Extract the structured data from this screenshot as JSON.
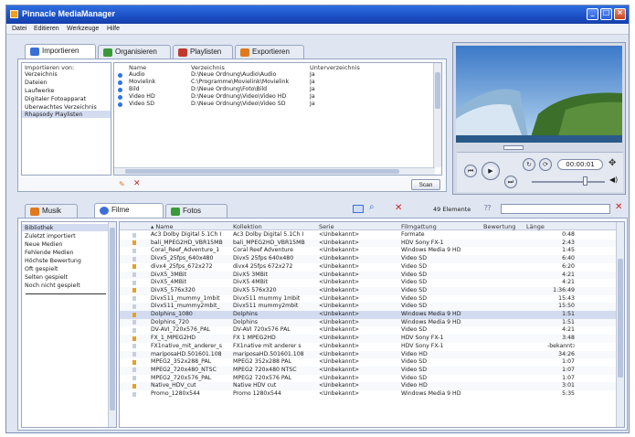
{
  "window": {
    "title": "Pinnacle MediaManager"
  },
  "menu": [
    "Datei",
    "Editieren",
    "Werkzeuge",
    "Hilfe"
  ],
  "top_tabs": [
    {
      "label": "Importieren",
      "icon": "import-icon",
      "color": "#3a6fd8"
    },
    {
      "label": "Organisieren",
      "icon": "organize-icon",
      "color": "#3a9a3a"
    },
    {
      "label": "Playlisten",
      "icon": "playlist-icon",
      "color": "#c0392b"
    },
    {
      "label": "Exportieren",
      "icon": "export-icon",
      "color": "#e07a1f"
    }
  ],
  "import_from": {
    "header": "Importieren von:",
    "items": [
      "Verzeichnis",
      "Dateien",
      "Laufwerke",
      "Digitaler Fotoapparat",
      "Überwachtes Verzeichnis",
      "Rhapsody Playlisten"
    ],
    "selected_index": 4
  },
  "import_table": {
    "columns": [
      "Name",
      "Verzeichnis",
      "Unterverzeichnis"
    ],
    "rows": [
      [
        "Audio",
        "D:\\Neue Ordnung\\Audio\\Audio",
        "Ja"
      ],
      [
        "Movielink",
        "C:\\Programme\\Movielink\\Movielink",
        "Ja"
      ],
      [
        "Bild",
        "D:\\Neue Ordnung\\Foto\\Bild",
        "Ja"
      ],
      [
        "Video HD",
        "D:\\Neue Ordnung\\Video\\Video HD",
        "Ja"
      ],
      [
        "Video SD",
        "D:\\Neue Ordnung\\Video\\Video SD",
        "Ja"
      ]
    ],
    "scan_button": "Scan"
  },
  "player": {
    "timecode": "00:00:01"
  },
  "bottom_tabs": [
    {
      "label": "Musik",
      "icon": "music-icon",
      "color": "#e07a1f"
    },
    {
      "label": "Filme",
      "icon": "film-icon",
      "color": "#3a6fd8"
    },
    {
      "label": "Fotos",
      "icon": "photo-icon",
      "color": "#3a9a3a"
    }
  ],
  "toolbar": {
    "count": "49 Elemente"
  },
  "library_nav": {
    "items": [
      "Bibliothek",
      "Zuletzt importiert",
      "Neue Medien",
      "Fehlende Medien",
      "Höchste Bewertung",
      "Oft gespielt",
      "Selten gespielt",
      "Noch nicht gespielt"
    ],
    "selected_index": 0
  },
  "film_table": {
    "columns": [
      "Name",
      "Kollektion",
      "Serie",
      "Filmgattung",
      "Bewertung",
      "Länge"
    ],
    "rows": [
      [
        "Ac3 Dolby Digital 5.1Ch I",
        "Ac3 Dolby Digital 5.1Ch I",
        "<Unbekannt>",
        "Formate",
        "",
        "0:48"
      ],
      [
        "bali_MPEG2HD_VBR15MB",
        "bali_MPEG2HD_VBR15MB",
        "<Unbekannt>",
        "HDV Sony FX-1",
        "",
        "2:43"
      ],
      [
        "Coral_Reef_Adventure_1",
        "Coral Reef Adventure",
        "<Unbekannt>",
        "Windows Media 9 HD",
        "",
        "1:45"
      ],
      [
        "Divx5_25fps_640x480",
        "Divx5 25fps 640x480",
        "<Unbekannt>",
        "Video SD",
        "",
        "6:40"
      ],
      [
        "divx4_25fps_672x272",
        "divx4 25fps 672x272",
        "<Unbekannt>",
        "Video SD",
        "",
        "6:20"
      ],
      [
        "DivX5_3MBit",
        "DivX5 3MBit",
        "<Unbekannt>",
        "Video SD",
        "",
        "4:21"
      ],
      [
        "DivX5_4MBit",
        "DivX5 4MBit",
        "<Unbekannt>",
        "Video SD",
        "",
        "4:21"
      ],
      [
        "DivX5_576x320",
        "DivX5 576x320",
        "<Unbekannt>",
        "Video SD",
        "",
        "1:36:49"
      ],
      [
        "Divx511_mummy_1mbit",
        "Divx511 mummy 1mbit",
        "<Unbekannt>",
        "Video SD",
        "",
        "15:43"
      ],
      [
        "Divx511_mummy2mbit_",
        "Divx511 mummy2mbit",
        "<Unbekannt>",
        "Video SD",
        "",
        "15:50"
      ],
      [
        "Dolphins_1080",
        "Dolphins",
        "<Unbekannt>",
        "Windows Media 9 HD",
        "",
        "1:51"
      ],
      [
        "Dolphins_720",
        "Dolphins",
        "<Unbekannt>",
        "Windows Media 9 HD",
        "",
        "1:51"
      ],
      [
        "DV-AVI_720x576_PAL",
        "DV-AVI 720x576 PAL",
        "<Unbekannt>",
        "Video SD",
        "",
        "4:21"
      ],
      [
        "FX_1_MPEG2HD",
        "FX 1 MPEG2HD",
        "<Unbekannt>",
        "HDV Sony FX-1",
        "",
        "3:48"
      ],
      [
        "FX1native_mit_anderer_s",
        "FX1native mit anderer s",
        "<Unbekannt>",
        "HDV Sony FX-1",
        "",
        "-bekannt>"
      ],
      [
        "mariposaHD.501601.108",
        "mariposaHD.501601.108",
        "<Unbekannt>",
        "Video HD",
        "",
        "34:26"
      ],
      [
        "MPEG2_352x288_PAL",
        "MPEG2 352x288 PAL",
        "<Unbekannt>",
        "Video SD",
        "",
        "1:07"
      ],
      [
        "MPEG2_720x480_NTSC",
        "MPEG2 720x480 NTSC",
        "<Unbekannt>",
        "Video SD",
        "",
        "1:07"
      ],
      [
        "MPEG2_720x576_PAL",
        "MPEG2 720x576 PAL",
        "<Unbekannt>",
        "Video SD",
        "",
        "1:07"
      ],
      [
        "Native_HDV_cut",
        "Native HDV cut",
        "<Unbekannt>",
        "Video HD",
        "",
        "3:01"
      ],
      [
        "Promo_1280x544",
        "Promo 1280x544",
        "<Unbekannt>",
        "Windows Media 9 HD",
        "",
        "5:35"
      ]
    ],
    "selected_index": 10
  },
  "colors": {
    "accent": "#3a6fd8",
    "titlebar": "#1b4fc6",
    "selection": "#d3dbf0"
  }
}
